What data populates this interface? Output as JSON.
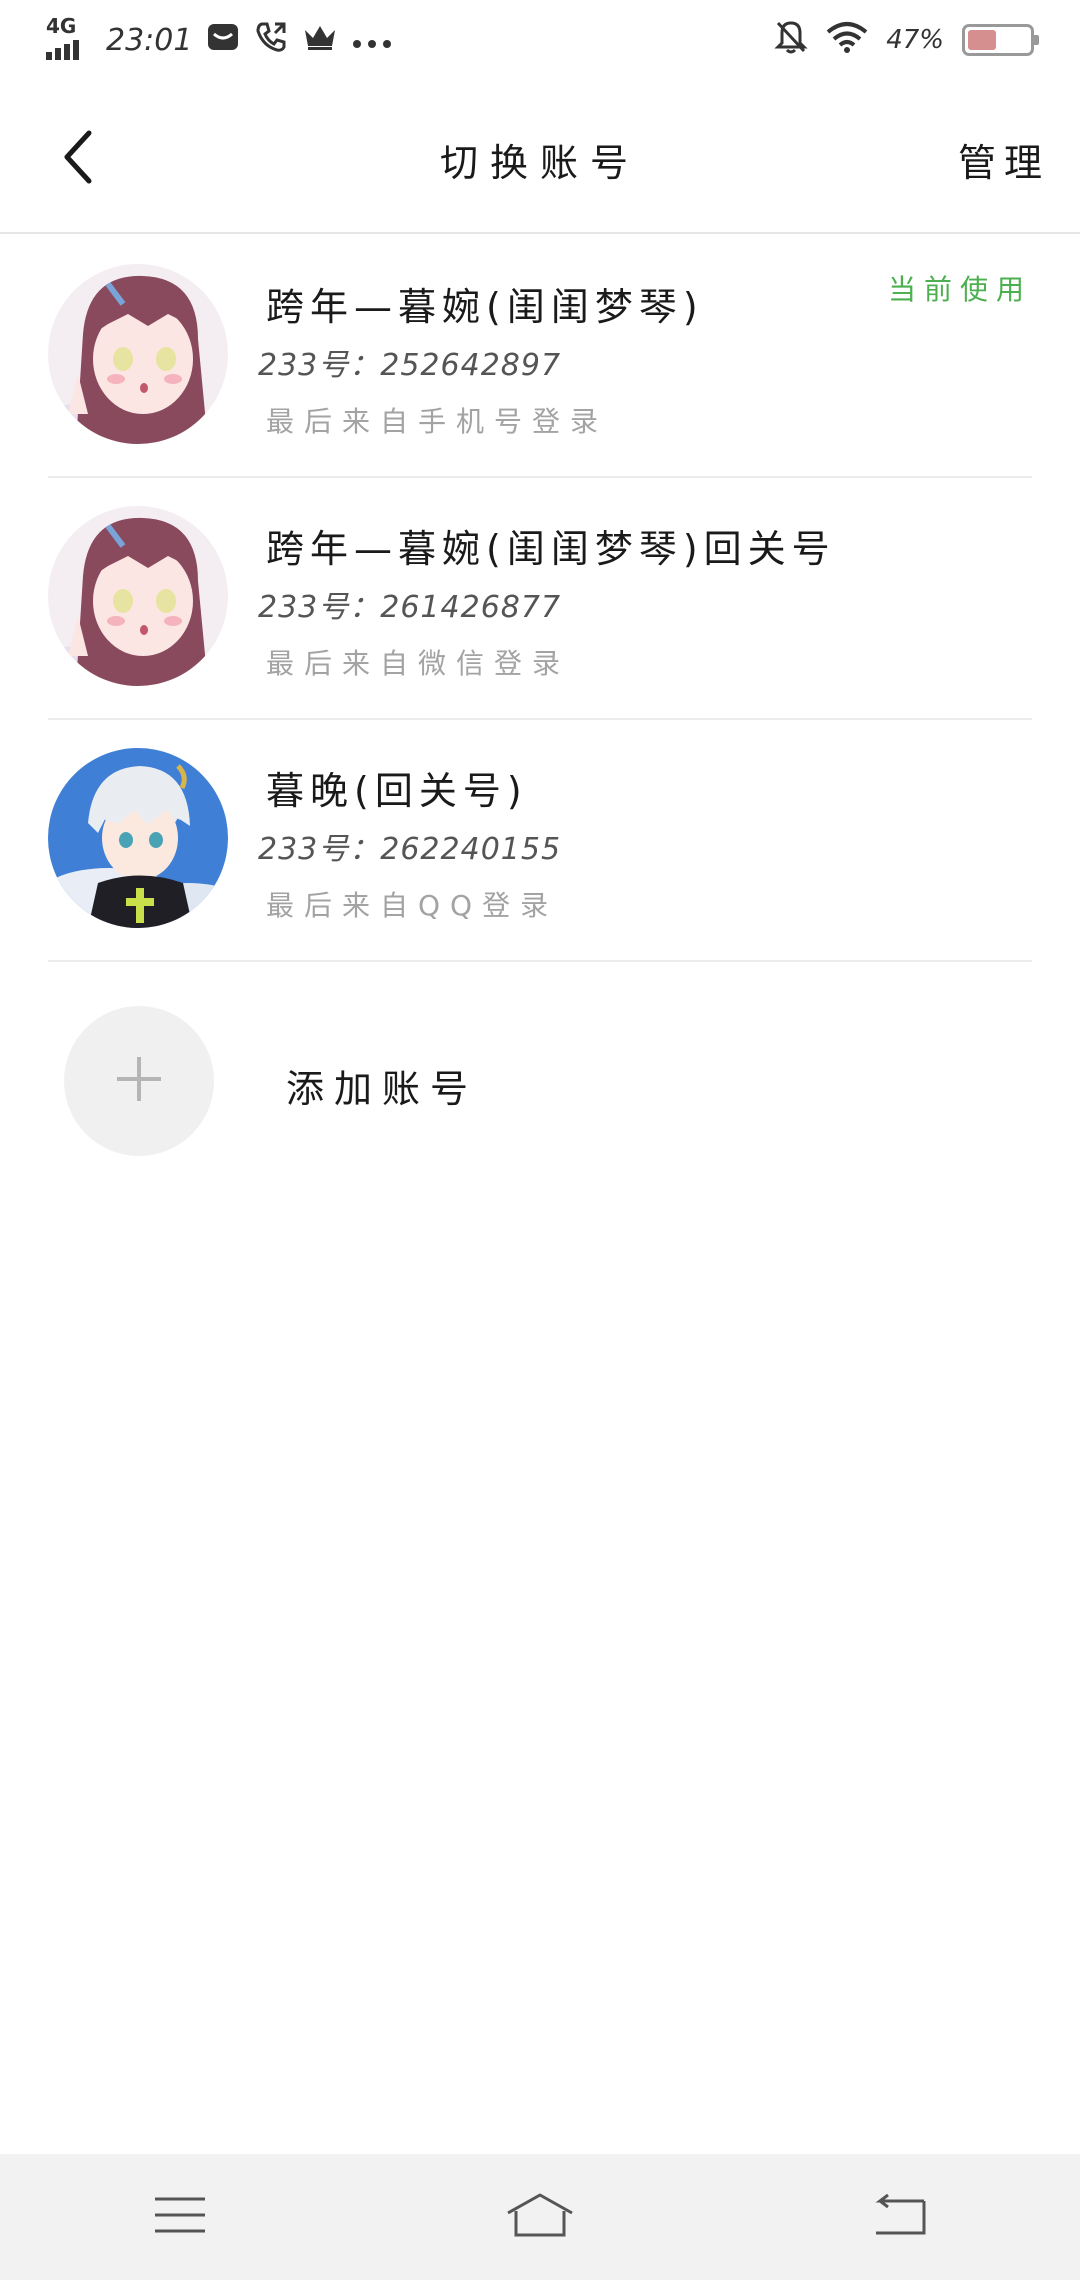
{
  "status_bar": {
    "network": "4G",
    "time": "23:01",
    "battery_percent": "47%",
    "battery_level": 0.47,
    "icons": [
      "network-signal-icon",
      "message-icon",
      "phone-call-icon",
      "crown-icon",
      "more-dots-icon",
      "bell-off-icon",
      "wifi-icon",
      "battery-icon"
    ]
  },
  "header": {
    "title": "切换账号",
    "manage_label": "管理",
    "back_icon": "chevron-left-icon"
  },
  "accounts": [
    {
      "name": "跨年—暮婉(闺闺梦琴)",
      "id_text": "233号：252642897",
      "login_text": "最后来自手机号登录",
      "current_label": "当前使用",
      "is_current": true,
      "avatar_icon": "avatar-anime-girl"
    },
    {
      "name": "跨年—暮婉(闺闺梦琴)回关号",
      "id_text": "233号：261426877",
      "login_text": "最后来自微信登录",
      "is_current": false,
      "avatar_icon": "avatar-anime-girl"
    },
    {
      "name": "暮晚(回关号)",
      "id_text": "233号：262240155",
      "login_text": "最后来自QQ登录",
      "is_current": false,
      "avatar_icon": "avatar-anime-boy"
    }
  ],
  "add_account": {
    "label": "添加账号",
    "icon": "plus-icon"
  },
  "nav_bar": {
    "icons": [
      "menu-icon",
      "home-icon",
      "back-icon"
    ]
  },
  "colors": {
    "accent_green": "#4caf50",
    "divider": "#ececec",
    "secondary_text": "#a3a3a3",
    "nav_background": "#f2f2f2"
  }
}
